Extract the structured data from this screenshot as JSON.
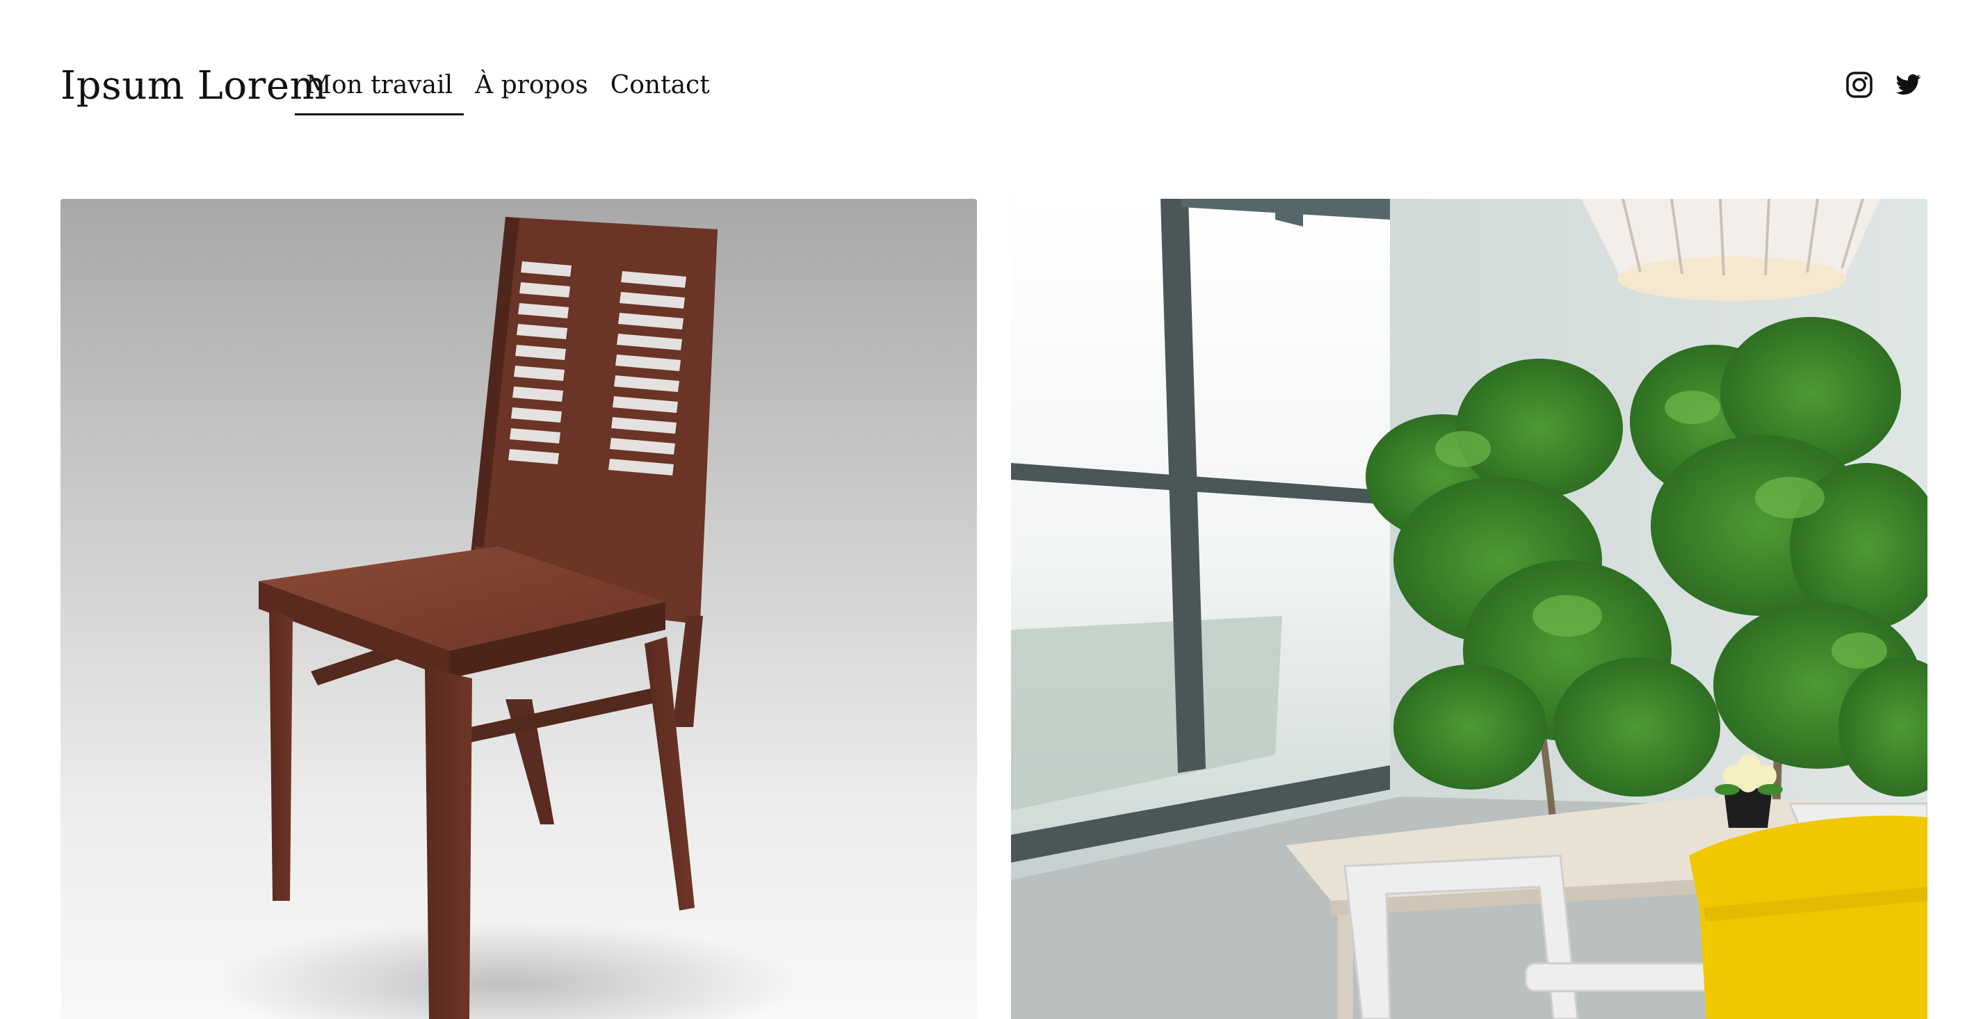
{
  "site": {
    "logo": "Ipsum Lorem"
  },
  "nav": {
    "items": [
      {
        "label": "Mon travail",
        "active": true
      },
      {
        "label": "À propos",
        "active": false
      },
      {
        "label": "Contact",
        "active": false
      }
    ]
  },
  "social": {
    "icons": [
      "instagram-icon",
      "twitter-icon"
    ]
  },
  "gallery": {
    "images": [
      {
        "name": "chair-photo"
      },
      {
        "name": "dining-room-photo"
      }
    ]
  },
  "colors": {
    "text": "#111111",
    "background": "#ffffff",
    "chair_wood": "#6b3628",
    "chair_yellow": "#f0c800",
    "plant_green": "#3f8a2c"
  }
}
